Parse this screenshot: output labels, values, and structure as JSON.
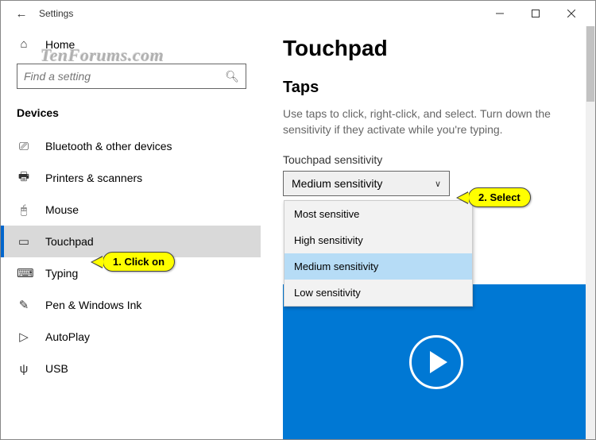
{
  "titlebar": {
    "back": "←",
    "title": "Settings"
  },
  "sidebar": {
    "home": "Home",
    "search_placeholder": "Find a setting",
    "category": "Devices",
    "items": [
      {
        "label": "Bluetooth & other devices"
      },
      {
        "label": "Printers & scanners"
      },
      {
        "label": "Mouse"
      },
      {
        "label": "Touchpad"
      },
      {
        "label": "Typing"
      },
      {
        "label": "Pen & Windows Ink"
      },
      {
        "label": "AutoPlay"
      },
      {
        "label": "USB"
      }
    ]
  },
  "main": {
    "page_title": "Touchpad",
    "section_title": "Taps",
    "section_desc": "Use taps to click, right-click, and select. Turn down the sensitivity if they activate while you're typing.",
    "sensitivity_label": "Touchpad sensitivity",
    "sensitivity_value": "Medium sensitivity",
    "sensitivity_options": [
      "Most sensitive",
      "High sensitivity",
      "Medium sensitivity",
      "Low sensitivity"
    ]
  },
  "callouts": {
    "c1": "1. Click on",
    "c2": "2. Select"
  },
  "watermark": "TenForums.com"
}
